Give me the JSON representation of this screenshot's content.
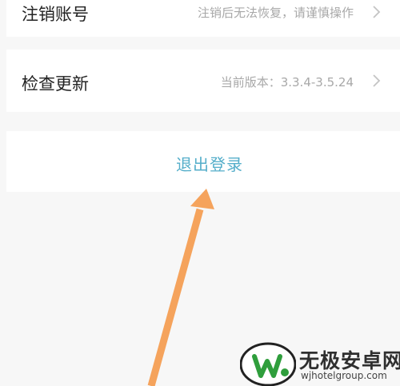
{
  "settings": {
    "cancel_account": {
      "label": "注销账号",
      "detail": "注销后无法恢复，请谨慎操作"
    },
    "check_update": {
      "label": "检查更新",
      "detail": "当前版本：3.3.4-3.5.24"
    }
  },
  "logout": {
    "label": "退出登录"
  },
  "annotation": {
    "arrow_color": "#f5a35c"
  },
  "watermark": {
    "name": "无极安卓网",
    "url": "wjhotelgroup.com"
  },
  "colors": {
    "logout_accent": "#55aeca",
    "background": "#f7f7f7"
  }
}
